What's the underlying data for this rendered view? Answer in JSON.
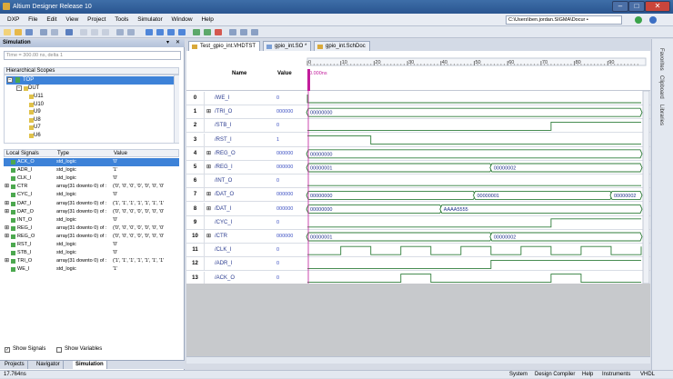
{
  "window": {
    "title": "Altium Designer Release 10"
  },
  "menu": {
    "items": [
      "DXP",
      "File",
      "Edit",
      "View",
      "Project",
      "Tools",
      "Simulator",
      "Window",
      "Help"
    ],
    "path": "C:\\Users\\ben.jordan.SIGMA\\Docur •"
  },
  "panel": {
    "title": "Simulation",
    "time_box": "Time = 300.00 ns, delta 1",
    "hier_title": "Hierarchical Scopes",
    "tree": [
      "TOP",
      "DUT",
      "U11",
      "U10",
      "U9",
      "U8",
      "U7",
      "U6"
    ],
    "cols": [
      "Local Signals",
      "Type",
      "Value"
    ],
    "signals": [
      [
        "ACK_O",
        "std_logic",
        "'0'"
      ],
      [
        "ADR_I",
        "std_logic",
        "'1'"
      ],
      [
        "CLK_I",
        "std_logic",
        "'0'"
      ],
      [
        "CTR",
        "array(31 downto 0) of :",
        "('0', '0', '0', '0', '0', '0', '0'"
      ],
      [
        "CYC_I",
        "std_logic",
        "'0'"
      ],
      [
        "DAT_I",
        "array(31 downto 0) of :",
        "('1', '1', '1', '1', '1', '1', '1'"
      ],
      [
        "DAT_O",
        "array(31 downto 0) of :",
        "('0', '0', '0', '0', '0', '0', '0'"
      ],
      [
        "INT_O",
        "std_logic",
        "'0'"
      ],
      [
        "REG_I",
        "array(31 downto 0) of :",
        "('0', '0', '0', '0', '0', '0', '0'"
      ],
      [
        "REG_O",
        "array(31 downto 0) of :",
        "('0', '0', '0', '0', '0', '0', '0'"
      ],
      [
        "RST_I",
        "std_logic",
        "'0'"
      ],
      [
        "STB_I",
        "std_logic",
        "'0'"
      ],
      [
        "TRI_O",
        "array(31 downto 0) of :",
        "('1', '1', '1', '1', '1', '1', '1'"
      ],
      [
        "WE_I",
        "std_logic",
        "'1'"
      ]
    ],
    "show_signals": "Show Signals",
    "show_variables": "Show Variables",
    "tabs": [
      "Projects",
      "Navigator",
      "Simulation"
    ]
  },
  "doc_tabs": [
    "Test_gpio_int.VHDTST",
    "gpio_int.SO *",
    "gpio_int.SchDoc"
  ],
  "wave": {
    "col_name": "Name",
    "col_value": "Value",
    "cursor": "0.000ns",
    "unit": "ns",
    "ticks": [
      "0",
      "10",
      "20",
      "30",
      "40",
      "50",
      "60",
      "70",
      "80",
      "90"
    ],
    "rows": [
      {
        "n": "0",
        "name": "/WE_I",
        "val": "0",
        "kind": "bit",
        "edges": [
          0
        ],
        "start": 1
      },
      {
        "n": "1",
        "name": "/TRI_O",
        "val": "000000",
        "kind": "bus",
        "segs": [
          {
            "t": 0,
            "v": "00000000"
          }
        ]
      },
      {
        "n": "2",
        "name": "/STB_I",
        "val": "0",
        "kind": "bit",
        "edges": [
          73
        ],
        "start": 0
      },
      {
        "n": "3",
        "name": "/RST_I",
        "val": "1",
        "kind": "bit",
        "edges": [
          19
        ],
        "start": 1
      },
      {
        "n": "4",
        "name": "/REG_O",
        "val": "000000",
        "kind": "bus",
        "segs": [
          {
            "t": 0,
            "v": "00000000"
          }
        ]
      },
      {
        "n": "5",
        "name": "/REG_I",
        "val": "000000",
        "kind": "bus",
        "segs": [
          {
            "t": 0,
            "v": "00000001"
          },
          {
            "t": 55,
            "v": "00000002"
          }
        ]
      },
      {
        "n": "6",
        "name": "/INT_O",
        "val": "0",
        "kind": "bit",
        "edges": [],
        "start": 0
      },
      {
        "n": "7",
        "name": "/DAT_O",
        "val": "000000",
        "kind": "bus",
        "segs": [
          {
            "t": 0,
            "v": "00000000"
          },
          {
            "t": 50,
            "v": "00000001"
          },
          {
            "t": 91,
            "v": "00000002"
          }
        ]
      },
      {
        "n": "8",
        "name": "/DAT_I",
        "val": "000000",
        "kind": "bus",
        "segs": [
          {
            "t": 0,
            "v": "00000000"
          },
          {
            "t": 40,
            "v": "AAAA5555"
          }
        ]
      },
      {
        "n": "9",
        "name": "/CYC_I",
        "val": "0",
        "kind": "bit",
        "edges": [
          73
        ],
        "start": 0
      },
      {
        "n": "10",
        "name": "/CTR",
        "val": "000000",
        "kind": "bus",
        "segs": [
          {
            "t": 0,
            "v": "00000001"
          },
          {
            "t": 55,
            "v": "00000002"
          }
        ]
      },
      {
        "n": "11",
        "name": "/CLK_I",
        "val": "0",
        "kind": "bit",
        "edges": [
          10,
          19,
          28,
          37,
          46,
          55,
          64,
          73,
          82,
          91,
          100
        ],
        "start": 0
      },
      {
        "n": "12",
        "name": "/ADR_I",
        "val": "0",
        "kind": "bit",
        "edges": [
          55
        ],
        "start": 0
      },
      {
        "n": "13",
        "name": "/ACK_O",
        "val": "0",
        "kind": "bit",
        "edges": [
          28,
          37,
          73,
          82
        ],
        "start": 0
      }
    ]
  },
  "right_panel": [
    "Favorites",
    "Clipboard",
    "Libraries"
  ],
  "status": {
    "left": "17.764ns",
    "items": [
      "System",
      "Design Compiler",
      "Help",
      "Instruments",
      "VHDL"
    ]
  }
}
